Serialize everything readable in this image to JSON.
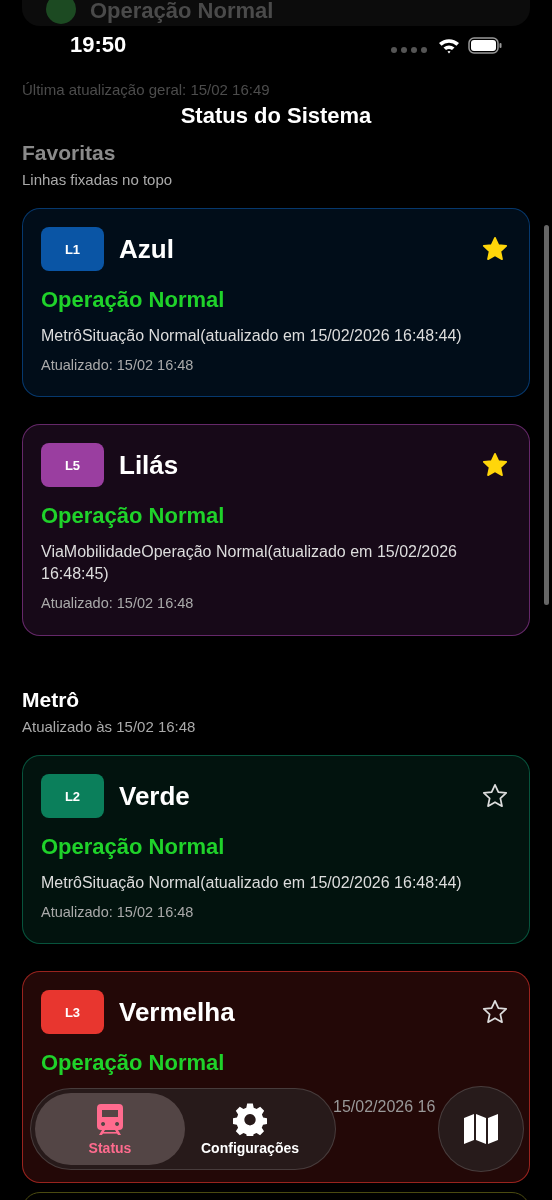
{
  "status_bar": {
    "time": "19:50"
  },
  "ghost": {
    "status": "Operação Normal",
    "updated": "Última atualização geral: 15/02 16:49"
  },
  "title": "Status do Sistema",
  "sections": [
    {
      "title": "Favoritas",
      "subtitle": "Linhas fixadas no topo",
      "faded": true,
      "lines": [
        {
          "code": "L1",
          "name": "Azul",
          "color": "#0a55a5",
          "favorite": true,
          "status": "Operação Normal",
          "desc": "MetrôSituação Normal(atualizado em 15/02/2026 16:48:44)",
          "updated": "Atualizado: 15/02 16:48"
        },
        {
          "code": "L5",
          "name": "Lilás",
          "color": "#9a3ea0",
          "favorite": true,
          "status": "Operação Normal",
          "desc": "ViaMobilidadeOperação Normal(atualizado em 15/02/2026 16:48:45)",
          "updated": "Atualizado: 15/02 16:48"
        }
      ]
    },
    {
      "title": "Metrô",
      "subtitle": "Atualizado às 15/02 16:48",
      "faded": false,
      "lines": [
        {
          "code": "L2",
          "name": "Verde",
          "color": "#0b7f5b",
          "favorite": false,
          "status": "Operação Normal",
          "desc": "MetrôSituação Normal(atualizado em 15/02/2026 16:48:44)",
          "updated": "Atualizado: 15/02 16:48"
        },
        {
          "code": "L3",
          "name": "Vermelha",
          "color": "#e8362f",
          "favorite": false,
          "status": "Operação Normal",
          "desc": "15/02/2026 16",
          "partial": true
        }
      ]
    }
  ],
  "tabs": [
    {
      "label": "Status",
      "kind": "train",
      "selected": true
    },
    {
      "label": "Configurações",
      "kind": "gear",
      "selected": false
    }
  ]
}
